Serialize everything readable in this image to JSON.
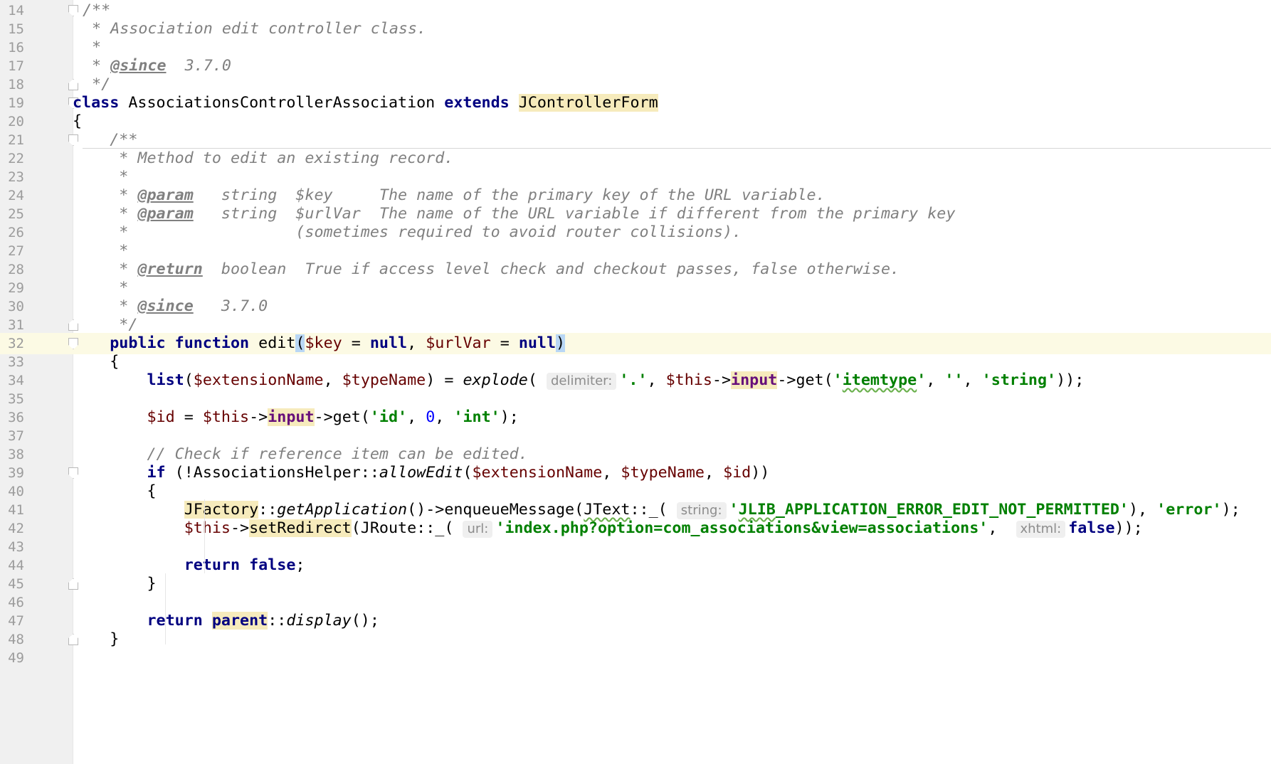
{
  "editor": {
    "current_line": 32,
    "lines": [
      {
        "n": "14"
      },
      {
        "n": "15"
      },
      {
        "n": "16"
      },
      {
        "n": "17"
      },
      {
        "n": "18"
      },
      {
        "n": "19"
      },
      {
        "n": "20"
      },
      {
        "n": "21"
      },
      {
        "n": "22"
      },
      {
        "n": "23"
      },
      {
        "n": "24"
      },
      {
        "n": "25"
      },
      {
        "n": "26"
      },
      {
        "n": "27"
      },
      {
        "n": "28"
      },
      {
        "n": "29"
      },
      {
        "n": "30"
      },
      {
        "n": "31"
      },
      {
        "n": "32"
      },
      {
        "n": "33"
      },
      {
        "n": "34"
      },
      {
        "n": "35"
      },
      {
        "n": "36"
      },
      {
        "n": "37"
      },
      {
        "n": "38"
      },
      {
        "n": "39"
      },
      {
        "n": "40"
      },
      {
        "n": "41"
      },
      {
        "n": "42"
      },
      {
        "n": "43"
      },
      {
        "n": "44"
      },
      {
        "n": "45"
      },
      {
        "n": "46"
      },
      {
        "n": "47"
      },
      {
        "n": "48"
      },
      {
        "n": "49"
      }
    ]
  },
  "code": {
    "l14": "/**",
    "l15": " * Association edit controller class.",
    "l16": " *",
    "l17_pre": " * ",
    "l17_tag": "@since",
    "l17_post": "  3.7.0",
    "l18": " */",
    "l19_kw1": "class",
    "l19_name": " AssociationsControllerAssociation ",
    "l19_kw2": "extends",
    "l19_sp": " ",
    "l19_parent": "JControllerForm",
    "l20": "{",
    "l21": "    /**",
    "l22": "     * Method to edit an existing record.",
    "l23": "     *",
    "l24_pre": "     * ",
    "l24_tag": "@param",
    "l24_post": "   string  $key     The name of the primary key of the URL variable.",
    "l25_pre": "     * ",
    "l25_tag": "@param",
    "l25_post": "   string  $urlVar  The name of the URL variable if different from the primary key",
    "l26": "     *                  (sometimes required to avoid router collisions).",
    "l27": "     *",
    "l28_pre": "     * ",
    "l28_tag": "@return",
    "l28_post": "  boolean  True if access level check and checkout passes, false otherwise.",
    "l29": "     *",
    "l30_pre": "     * ",
    "l30_tag": "@since",
    "l30_post": "   3.7.0",
    "l31": "     */",
    "l32_indent": "    ",
    "l32_kw1": "public",
    "l32_sp1": " ",
    "l32_kw2": "function",
    "l32_fn": " edit",
    "l32_lp": "(",
    "l32_v1": "$key",
    "l32_eq1": " = ",
    "l32_null1": "null",
    "l32_comma": ", ",
    "l32_v2": "$urlVar",
    "l32_eq2": " = ",
    "l32_null2": "null",
    "l32_rp": ")",
    "l33": "    {",
    "l34_indent": "        ",
    "l34_list": "list",
    "l34_a": "(",
    "l34_v1": "$extensionName",
    "l34_b": ", ",
    "l34_v2": "$typeName",
    "l34_c": ") = ",
    "l34_explode": "explode",
    "l34_d": "( ",
    "l34_hint": "delimiter:",
    "l34_s1": "'.'",
    "l34_e": ", ",
    "l34_this": "$this",
    "l34_arrow": "->",
    "l34_input": "input",
    "l34_get": "->get(",
    "l34_s2a": "'",
    "l34_s2b": "itemtype",
    "l34_s2c": "'",
    "l34_f": ", ",
    "l34_s3": "''",
    "l34_g": ", ",
    "l34_s4": "'string'",
    "l34_h": "));",
    "l36_indent": "        ",
    "l36_id": "$id",
    "l36_a": " = ",
    "l36_this": "$this",
    "l36_arrow": "->",
    "l36_input": "input",
    "l36_get": "->get(",
    "l36_s1": "'id'",
    "l36_b": ", ",
    "l36_n": "0",
    "l36_c": ", ",
    "l36_s2": "'int'",
    "l36_d": ");",
    "l38": "        // Check if reference item can be edited.",
    "l39_indent": "        ",
    "l39_if": "if",
    "l39_a": " (!AssociationsHelper::",
    "l39_fn": "allowEdit",
    "l39_b": "(",
    "l39_v1": "$extensionName",
    "l39_c": ", ",
    "l39_v2": "$typeName",
    "l39_d": ", ",
    "l39_v3": "$id",
    "l39_e": "))",
    "l40": "        {",
    "l41_indent": "            ",
    "l41_jf": "JFactory",
    "l41_a": "::",
    "l41_fn": "getApplication",
    "l41_b": "()->enqueueMessage(",
    "l41_jt": "JText",
    "l41_c": "::_( ",
    "l41_hint": "string:",
    "l41_s1a": "'",
    "l41_s1b": "JLIB",
    "l41_s1c": "_APPLICATION_ERROR_EDIT_NOT_PERMITTED'",
    "l41_d": "), ",
    "l41_s2": "'error'",
    "l41_e": ");",
    "l42_indent": "            ",
    "l42_this": "$this",
    "l42_arrow": "->",
    "l42_fn": "setRedirect",
    "l42_a": "(JRoute::_( ",
    "l42_hint1": "url:",
    "l42_s1": "'index.php?option=com_associations&view=associations'",
    "l42_b": ",  ",
    "l42_hint2": "xhtml:",
    "l42_false": "false",
    "l42_c": "));",
    "l44_indent": "            ",
    "l44_ret": "return",
    "l44_sp": " ",
    "l44_false": "false",
    "l44_semi": ";",
    "l45": "        }",
    "l47_indent": "        ",
    "l47_ret": "return",
    "l47_sp": " ",
    "l47_parent": "parent",
    "l47_a": "::",
    "l47_fn": "display",
    "l47_b": "();",
    "l48": "    }"
  }
}
